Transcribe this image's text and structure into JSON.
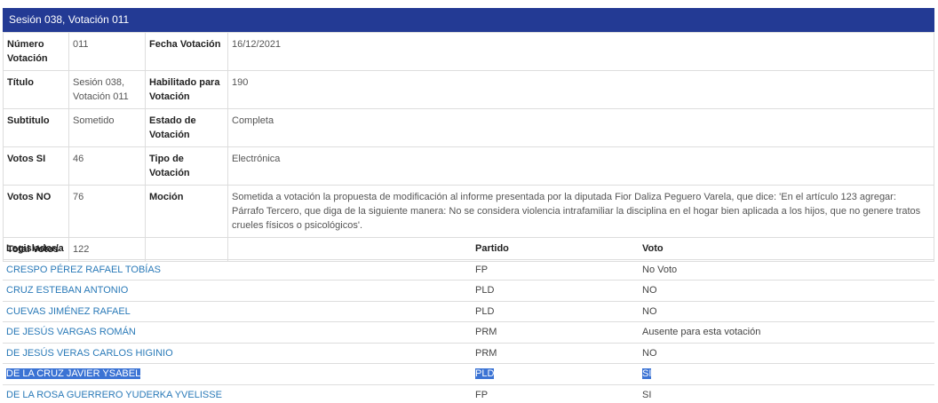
{
  "header": {
    "title": "Sesión 038, Votación 011"
  },
  "info": {
    "numero_label": "Número Votación",
    "numero_value": "011",
    "fecha_label": "Fecha Votación",
    "fecha_value": "16/12/2021",
    "titulo_label": "Título",
    "titulo_value": "Sesión 038, Votación 011",
    "habilitado_label": "Habilitado para Votación",
    "habilitado_value": "190",
    "subtitulo_label": "Subtitulo",
    "subtitulo_value": "Sometido",
    "estado_label": "Estado de Votación",
    "estado_value": "Completa",
    "votos_si_label": "Votos SI",
    "votos_si_value": "46",
    "tipo_label": "Tipo de Votación",
    "tipo_value": "Electrónica",
    "votos_no_label": "Votos NO",
    "votos_no_value": "76",
    "mocion_label": "Moción",
    "mocion_value": "Sometida a votación la propuesta de modificación al informe presentada por la diputada Fior Daliza Peguero Varela, que dice: 'En el artículo 123 agregar: Párrafo Tercero, que diga de la siguiente manera: No se considera violencia intrafamiliar la disciplina en el hogar bien aplicada a los hijos, que no genere tratos crueles físicos o psicológicos'.",
    "total_label": "Total Votos",
    "total_value": "122"
  },
  "votes": {
    "headers": [
      "Legislador/a",
      "Partido",
      "Voto"
    ],
    "rows": [
      {
        "name": "CRESPO PÉREZ RAFAEL TOBÍAS",
        "party": "FP",
        "vote": "No Voto"
      },
      {
        "name": "CRUZ ESTEBAN ANTONIO",
        "party": "PLD",
        "vote": "NO"
      },
      {
        "name": "CUEVAS JIMÉNEZ RAFAEL",
        "party": "PLD",
        "vote": "NO"
      },
      {
        "name": "DE JESÚS VARGAS ROMÁN",
        "party": "PRM",
        "vote": "Ausente para esta votación"
      },
      {
        "name": "DE JESÚS VERAS CARLOS HIGINIO",
        "party": "PRM",
        "vote": "NO"
      },
      {
        "name": "DE LA CRUZ JAVIER YSABEL",
        "party": "PLD",
        "vote": "SI"
      },
      {
        "name": "DE LA ROSA GUERRERO YUDERKA YVELISSE",
        "party": "FP",
        "vote": "SI"
      }
    ]
  },
  "colors": {
    "header_bg": "#233a94",
    "link": "#2a7ab8",
    "selection": "#3b73d4"
  }
}
